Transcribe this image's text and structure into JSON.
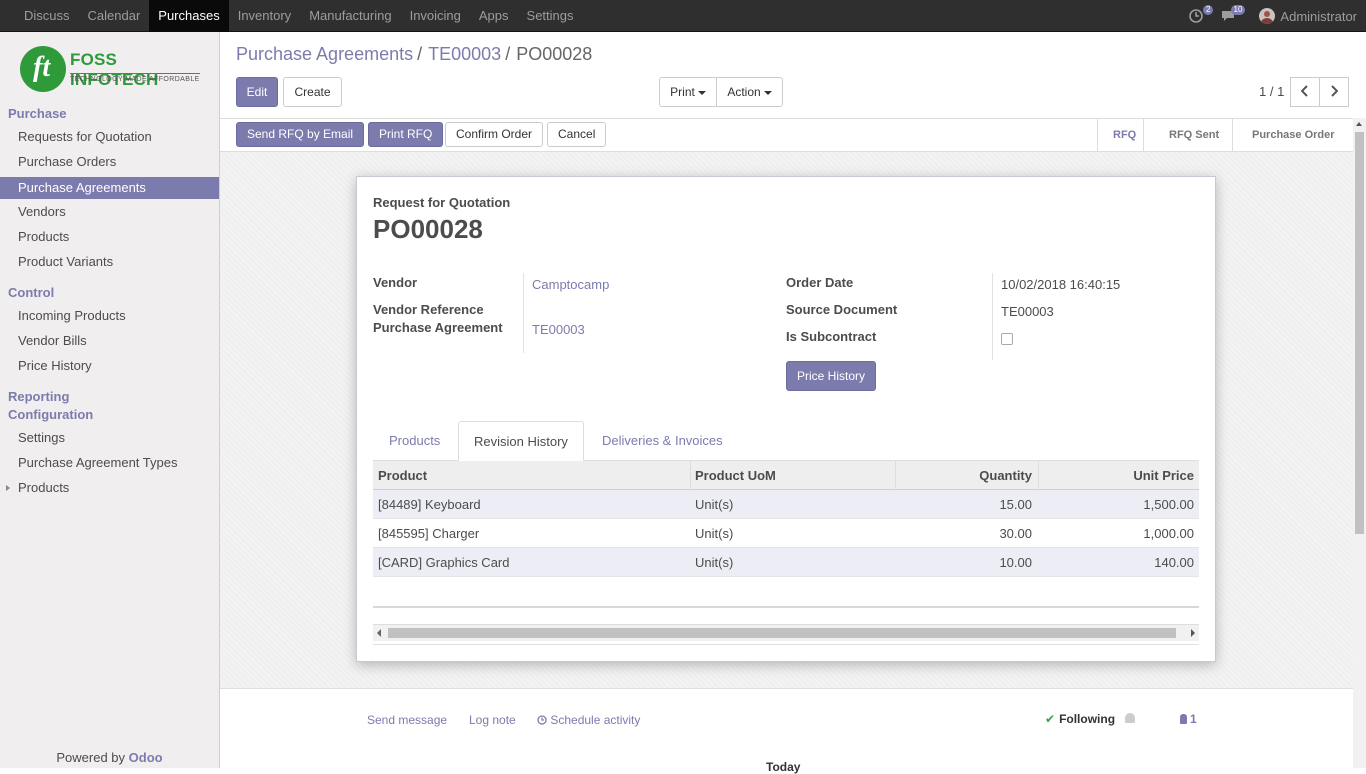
{
  "topbar": {
    "apps": [
      "Discuss",
      "Calendar",
      "Purchases",
      "Inventory",
      "Manufacturing",
      "Invoicing",
      "Apps",
      "Settings"
    ],
    "active_app": "Purchases",
    "activity_count": "2",
    "message_count": "10",
    "user": "Administrator"
  },
  "logo": {
    "name": "FOSS INFOTECH",
    "tagline": "TECHNOLOGY MADE AFFORDABLE",
    "mark": "ft"
  },
  "sidebar": {
    "purchase_heading": "Purchase",
    "purchase_items": [
      "Requests for Quotation",
      "Purchase Orders",
      "Purchase Agreements",
      "Vendors",
      "Products",
      "Product Variants"
    ],
    "control_heading": "Control",
    "control_items": [
      "Incoming Products",
      "Vendor Bills",
      "Price History"
    ],
    "reporting_heading": "Reporting",
    "configuration_heading": "Configuration",
    "config_items": [
      "Settings",
      "Purchase Agreement Types",
      "Products"
    ],
    "powered_by": "Powered by",
    "powered_brand": "Odoo"
  },
  "breadcrumb": {
    "root": "Purchase Agreements",
    "mid": "TE00003",
    "current": "PO00028",
    "sep": "/"
  },
  "buttons": {
    "edit": "Edit",
    "create": "Create",
    "print": "Print",
    "action": "Action"
  },
  "pager": {
    "value": "1 / 1"
  },
  "statusbar": {
    "buttons": [
      "Send RFQ by Email",
      "Print RFQ",
      "Confirm Order",
      "Cancel"
    ],
    "stages": [
      "RFQ",
      "RFQ Sent",
      "Purchase Order"
    ],
    "active_stage": "RFQ"
  },
  "form": {
    "doc_type": "Request for Quotation",
    "name": "PO00028",
    "vendor_label": "Vendor",
    "vendor": "Camptocamp",
    "vendor_ref_label": "Vendor Reference",
    "agreement_label": "Purchase Agreement",
    "agreement": "TE00003",
    "order_date_label": "Order Date",
    "order_date": "10/02/2018 16:40:15",
    "source_label": "Source Document",
    "source": "TE00003",
    "subcontract_label": "Is Subcontract",
    "subcontract": false,
    "price_history_button": "Price History"
  },
  "tabs": [
    "Products",
    "Revision History",
    "Deliveries & Invoices"
  ],
  "active_tab": "Revision History",
  "table": {
    "columns": [
      "Product",
      "Product UoM",
      "Quantity",
      "Unit Price"
    ],
    "rows": [
      {
        "product": "[84489] Keyboard",
        "uom": "Unit(s)",
        "qty": "15.00",
        "price": "1,500.00"
      },
      {
        "product": "[845595] Charger",
        "uom": "Unit(s)",
        "qty": "30.00",
        "price": "1,000.00"
      },
      {
        "product": "[CARD] Graphics Card",
        "uom": "Unit(s)",
        "qty": "10.00",
        "price": "140.00"
      }
    ]
  },
  "chatter": {
    "send_message": "Send message",
    "log_note": "Log note",
    "schedule_activity": "Schedule activity",
    "following": "Following",
    "followers": "1",
    "today": "Today"
  },
  "colors": {
    "accent": "#7c7bad",
    "topbar": "#2f2f2f",
    "brand_green": "#2e9a3a"
  }
}
